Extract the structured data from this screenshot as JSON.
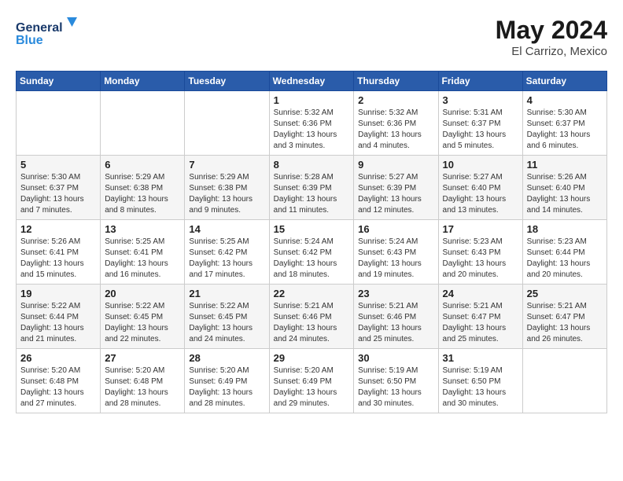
{
  "header": {
    "logo_line1": "General",
    "logo_line2": "Blue",
    "month": "May 2024",
    "location": "El Carrizo, Mexico"
  },
  "days_of_week": [
    "Sunday",
    "Monday",
    "Tuesday",
    "Wednesday",
    "Thursday",
    "Friday",
    "Saturday"
  ],
  "weeks": [
    [
      {
        "day": "",
        "info": ""
      },
      {
        "day": "",
        "info": ""
      },
      {
        "day": "",
        "info": ""
      },
      {
        "day": "1",
        "info": "Sunrise: 5:32 AM\nSunset: 6:36 PM\nDaylight: 13 hours and 3 minutes."
      },
      {
        "day": "2",
        "info": "Sunrise: 5:32 AM\nSunset: 6:36 PM\nDaylight: 13 hours and 4 minutes."
      },
      {
        "day": "3",
        "info": "Sunrise: 5:31 AM\nSunset: 6:37 PM\nDaylight: 13 hours and 5 minutes."
      },
      {
        "day": "4",
        "info": "Sunrise: 5:30 AM\nSunset: 6:37 PM\nDaylight: 13 hours and 6 minutes."
      }
    ],
    [
      {
        "day": "5",
        "info": "Sunrise: 5:30 AM\nSunset: 6:37 PM\nDaylight: 13 hours and 7 minutes."
      },
      {
        "day": "6",
        "info": "Sunrise: 5:29 AM\nSunset: 6:38 PM\nDaylight: 13 hours and 8 minutes."
      },
      {
        "day": "7",
        "info": "Sunrise: 5:29 AM\nSunset: 6:38 PM\nDaylight: 13 hours and 9 minutes."
      },
      {
        "day": "8",
        "info": "Sunrise: 5:28 AM\nSunset: 6:39 PM\nDaylight: 13 hours and 11 minutes."
      },
      {
        "day": "9",
        "info": "Sunrise: 5:27 AM\nSunset: 6:39 PM\nDaylight: 13 hours and 12 minutes."
      },
      {
        "day": "10",
        "info": "Sunrise: 5:27 AM\nSunset: 6:40 PM\nDaylight: 13 hours and 13 minutes."
      },
      {
        "day": "11",
        "info": "Sunrise: 5:26 AM\nSunset: 6:40 PM\nDaylight: 13 hours and 14 minutes."
      }
    ],
    [
      {
        "day": "12",
        "info": "Sunrise: 5:26 AM\nSunset: 6:41 PM\nDaylight: 13 hours and 15 minutes."
      },
      {
        "day": "13",
        "info": "Sunrise: 5:25 AM\nSunset: 6:41 PM\nDaylight: 13 hours and 16 minutes."
      },
      {
        "day": "14",
        "info": "Sunrise: 5:25 AM\nSunset: 6:42 PM\nDaylight: 13 hours and 17 minutes."
      },
      {
        "day": "15",
        "info": "Sunrise: 5:24 AM\nSunset: 6:42 PM\nDaylight: 13 hours and 18 minutes."
      },
      {
        "day": "16",
        "info": "Sunrise: 5:24 AM\nSunset: 6:43 PM\nDaylight: 13 hours and 19 minutes."
      },
      {
        "day": "17",
        "info": "Sunrise: 5:23 AM\nSunset: 6:43 PM\nDaylight: 13 hours and 20 minutes."
      },
      {
        "day": "18",
        "info": "Sunrise: 5:23 AM\nSunset: 6:44 PM\nDaylight: 13 hours and 20 minutes."
      }
    ],
    [
      {
        "day": "19",
        "info": "Sunrise: 5:22 AM\nSunset: 6:44 PM\nDaylight: 13 hours and 21 minutes."
      },
      {
        "day": "20",
        "info": "Sunrise: 5:22 AM\nSunset: 6:45 PM\nDaylight: 13 hours and 22 minutes."
      },
      {
        "day": "21",
        "info": "Sunrise: 5:22 AM\nSunset: 6:45 PM\nDaylight: 13 hours and 24 minutes."
      },
      {
        "day": "22",
        "info": "Sunrise: 5:21 AM\nSunset: 6:46 PM\nDaylight: 13 hours and 24 minutes."
      },
      {
        "day": "23",
        "info": "Sunrise: 5:21 AM\nSunset: 6:46 PM\nDaylight: 13 hours and 25 minutes."
      },
      {
        "day": "24",
        "info": "Sunrise: 5:21 AM\nSunset: 6:47 PM\nDaylight: 13 hours and 25 minutes."
      },
      {
        "day": "25",
        "info": "Sunrise: 5:21 AM\nSunset: 6:47 PM\nDaylight: 13 hours and 26 minutes."
      }
    ],
    [
      {
        "day": "26",
        "info": "Sunrise: 5:20 AM\nSunset: 6:48 PM\nDaylight: 13 hours and 27 minutes."
      },
      {
        "day": "27",
        "info": "Sunrise: 5:20 AM\nSunset: 6:48 PM\nDaylight: 13 hours and 28 minutes."
      },
      {
        "day": "28",
        "info": "Sunrise: 5:20 AM\nSunset: 6:49 PM\nDaylight: 13 hours and 28 minutes."
      },
      {
        "day": "29",
        "info": "Sunrise: 5:20 AM\nSunset: 6:49 PM\nDaylight: 13 hours and 29 minutes."
      },
      {
        "day": "30",
        "info": "Sunrise: 5:19 AM\nSunset: 6:50 PM\nDaylight: 13 hours and 30 minutes."
      },
      {
        "day": "31",
        "info": "Sunrise: 5:19 AM\nSunset: 6:50 PM\nDaylight: 13 hours and 30 minutes."
      },
      {
        "day": "",
        "info": ""
      }
    ]
  ]
}
